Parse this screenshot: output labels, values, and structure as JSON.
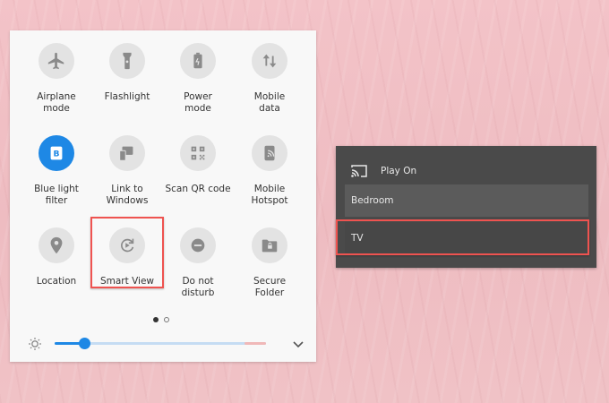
{
  "quick_settings": {
    "tiles": [
      {
        "label": "Airplane\nmode",
        "icon": "airplane-icon",
        "active": false
      },
      {
        "label": "Flashlight",
        "icon": "flashlight-icon",
        "active": false
      },
      {
        "label": "Power\nmode",
        "icon": "power-mode-icon",
        "active": false
      },
      {
        "label": "Mobile\ndata",
        "icon": "mobile-data-icon",
        "active": false
      },
      {
        "label": "Blue light\nfilter",
        "icon": "blue-light-icon",
        "active": true
      },
      {
        "label": "Link to\nWindows",
        "icon": "link-to-windows-icon",
        "active": false
      },
      {
        "label": "Scan QR code",
        "icon": "qr-code-icon",
        "active": false
      },
      {
        "label": "Mobile\nHotspot",
        "icon": "hotspot-icon",
        "active": false
      },
      {
        "label": "Location",
        "icon": "location-icon",
        "active": false
      },
      {
        "label": "Smart View",
        "icon": "smart-view-icon",
        "active": false
      },
      {
        "label": "Do not\ndisturb",
        "icon": "do-not-disturb-icon",
        "active": false
      },
      {
        "label": "Secure\nFolder",
        "icon": "secure-folder-icon",
        "active": false
      }
    ],
    "pages": {
      "current": 1,
      "total": 2
    },
    "brightness": {
      "level": 0.14
    },
    "blue_light_glyph": "B"
  },
  "cast_dialog": {
    "title": "Play On",
    "devices": [
      "Bedroom",
      "TV"
    ]
  },
  "colors": {
    "accent": "#1e88e5",
    "highlight": "#ef5350",
    "dialog_bg": "#4a4a4a"
  }
}
